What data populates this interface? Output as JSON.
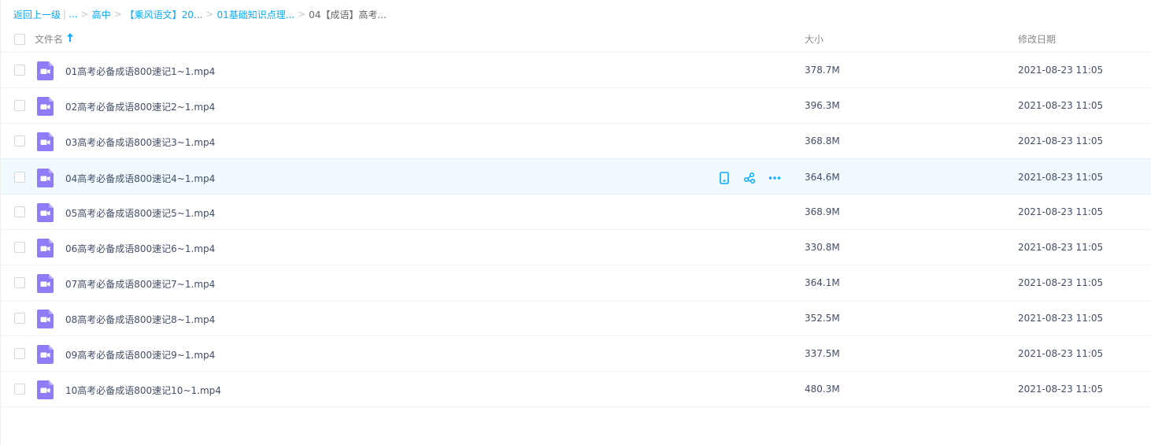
{
  "breadcrumb": {
    "back": "返回上一级",
    "ellipsis": "...",
    "items": [
      "高中",
      "【乘风语文】20...",
      "01基础知识点理..."
    ],
    "current": "04【成语】高考..."
  },
  "header": {
    "name_label": "文件名",
    "size_label": "大小",
    "date_label": "修改日期"
  },
  "icon_color": "#8f7cf6",
  "accent_color": "#09aaff",
  "rows": [
    {
      "name": "01高考必备成语800速记1~1.mp4",
      "size": "378.7M",
      "date": "2021-08-23 11:05"
    },
    {
      "name": "02高考必备成语800速记2~1.mp4",
      "size": "396.3M",
      "date": "2021-08-23 11:05"
    },
    {
      "name": "03高考必备成语800速记3~1.mp4",
      "size": "368.8M",
      "date": "2021-08-23 11:05"
    },
    {
      "name": "04高考必备成语800速记4~1.mp4",
      "size": "364.6M",
      "date": "2021-08-23 11:05"
    },
    {
      "name": "05高考必备成语800速记5~1.mp4",
      "size": "368.9M",
      "date": "2021-08-23 11:05"
    },
    {
      "name": "06高考必备成语800速记6~1.mp4",
      "size": "330.8M",
      "date": "2021-08-23 11:05"
    },
    {
      "name": "07高考必备成语800速记7~1.mp4",
      "size": "364.1M",
      "date": "2021-08-23 11:05"
    },
    {
      "name": "08高考必备成语800速记8~1.mp4",
      "size": "352.5M",
      "date": "2021-08-23 11:05"
    },
    {
      "name": "09高考必备成语800速记9~1.mp4",
      "size": "337.5M",
      "date": "2021-08-23 11:05"
    },
    {
      "name": "10高考必备成语800速记10~1.mp4",
      "size": "480.3M",
      "date": "2021-08-23 11:05"
    }
  ],
  "hover_row_index": 3,
  "row_actions": [
    "phone-icon",
    "share-icon",
    "more-icon"
  ]
}
